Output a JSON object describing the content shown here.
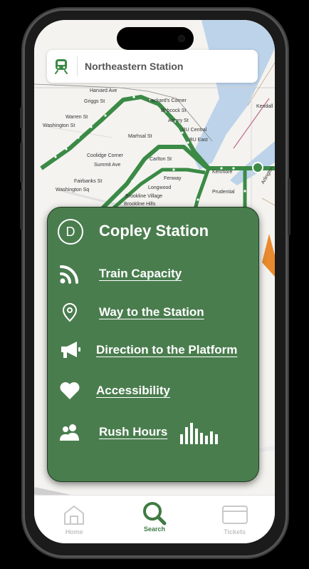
{
  "header": {
    "title": "Northeastern Station",
    "icon": "train-icon"
  },
  "card": {
    "badge": "D",
    "station": "Copley Station",
    "actions": [
      {
        "label": "Train Capacity",
        "icon": "wifi-signal-icon"
      },
      {
        "label": "Way to the Station",
        "icon": "location-pin-icon"
      },
      {
        "label": "Direction to the Platform",
        "icon": "megaphone-icon"
      },
      {
        "label": "Accessibility",
        "icon": "heart-icon"
      },
      {
        "label": "Rush Hours",
        "icon": "users-icon"
      }
    ]
  },
  "tabs": [
    {
      "label": "Home",
      "icon": "home-icon",
      "active": false
    },
    {
      "label": "Search",
      "icon": "search-icon",
      "active": true
    },
    {
      "label": "Tickets",
      "icon": "ticket-icon",
      "active": false
    }
  ],
  "map": {
    "labels": [
      "Harvard Ave",
      "Packard's Corner",
      "Griggs St",
      "Babcock St",
      "Warren St",
      "Amory St",
      "Washington St",
      "BU Central",
      "BU East",
      "Marhsal St",
      "Carlton St",
      "Coolidge Corner",
      "Summit Ave",
      "Fenway",
      "Kenmore",
      "Fairbanks St",
      "Longwood",
      "Washington Sq",
      "Brookline Village",
      "Prudential",
      "Brookline Hills",
      "Kendall",
      "Arlington"
    ]
  },
  "colors": {
    "brand_green": "#4a7d4e",
    "line_green": "#3b8a46",
    "water": "#bcd3ea"
  }
}
